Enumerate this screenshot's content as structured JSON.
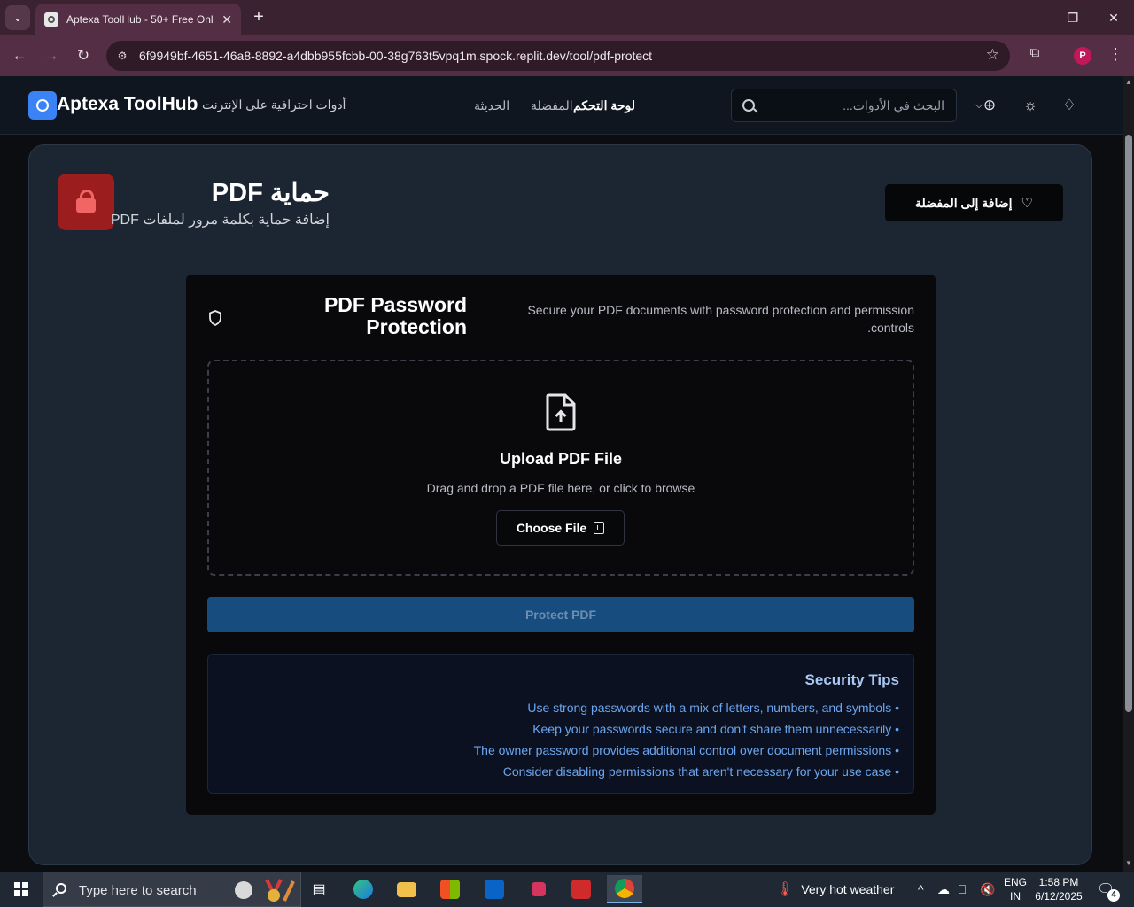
{
  "browser": {
    "tab_title": "Aptexa ToolHub - 50+ Free Onl",
    "url": "6f9949bf-4651-46a8-8892-a4dbb955fcbb-00-38g763t5vpq1m.spock.replit.dev/tool/pdf-protect",
    "profile_initial": "P"
  },
  "header": {
    "brand": "Aptexa ToolHub",
    "tagline": "أدوات احترافية على الإنترنت",
    "nav": {
      "recent": "الحديثة",
      "favorites": "المفضلة",
      "dashboard": "لوحة التحكم"
    },
    "search_placeholder": "البحث في الأدوات..."
  },
  "tool": {
    "title": "حماية PDF",
    "subtitle": "إضافة حماية بكلمة مرور لملفات PDF",
    "add_favorite": "إضافة إلى المفضلة",
    "icon_color": "#9b1d1d"
  },
  "panel": {
    "title": "PDF Password Protection",
    "description": "Secure your PDF documents with password protection and permission controls.",
    "upload_title": "Upload PDF File",
    "upload_hint": "Drag and drop a PDF file here, or click to browse",
    "choose_file": "Choose File",
    "protect_button": "Protect PDF"
  },
  "tips": {
    "title": "Security Tips",
    "items": [
      "Use strong passwords with a mix of letters, numbers, and symbols",
      "Keep your passwords secure and don't share them unnecessarily",
      "The owner password provides additional control over document permissions",
      "Consider disabling permissions that aren't necessary for your use case"
    ]
  },
  "taskbar": {
    "search_placeholder": "Type here to search",
    "weather": "Very hot weather",
    "lang_line1": "ENG",
    "lang_line2": "IN",
    "time": "1:58 PM",
    "date": "6/12/2025",
    "notification_count": "4"
  }
}
